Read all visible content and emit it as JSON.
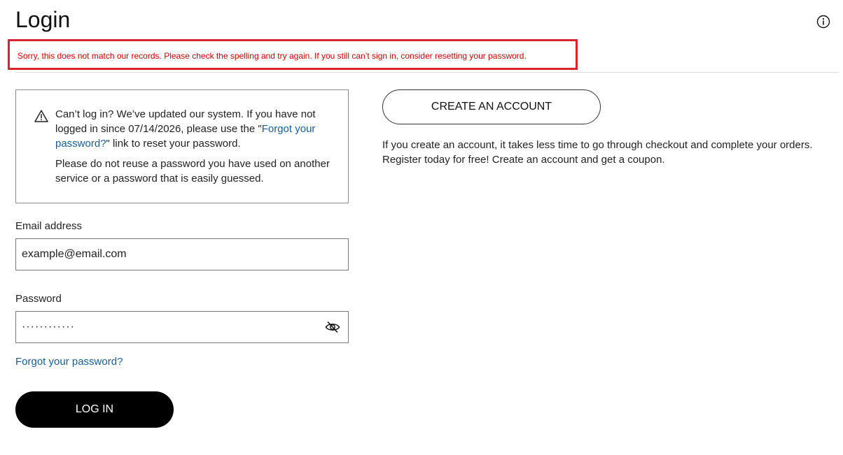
{
  "page": {
    "title": "Login"
  },
  "icons": {
    "info": "info-circle-icon",
    "warning": "warning-triangle-icon",
    "password_toggle": "eye-slash-icon"
  },
  "error": {
    "message": "Sorry, this does not match our records. Please check the spelling and try again. If you still can’t sign in, consider resetting your password.",
    "border_color": "#d9232e",
    "text_color": "#cc0000"
  },
  "notice": {
    "line1_before_link": "Can’t log in? We’ve updated our system. If you have not logged in since 07/14/2026, please use the \"",
    "link_text": "Forgot your password?",
    "line1_after_link": "\" link to reset your password.",
    "paragraph2": "Please do not reuse a password you have used on another service or a password that is easily guessed."
  },
  "form": {
    "email_label": "Email address",
    "email_value": "example@email.com",
    "password_label": "Password",
    "password_value": "············",
    "forgot_link": "Forgot your password?",
    "login_button": "LOG IN"
  },
  "register": {
    "create_button": "CREATE AN ACCOUNT",
    "description": "If you create an account, it takes less time to go through checkout and complete your orders. Register today for free! Create an account and get a coupon."
  },
  "colors": {
    "link": "#1a5b96",
    "primary_button": "#000000"
  }
}
